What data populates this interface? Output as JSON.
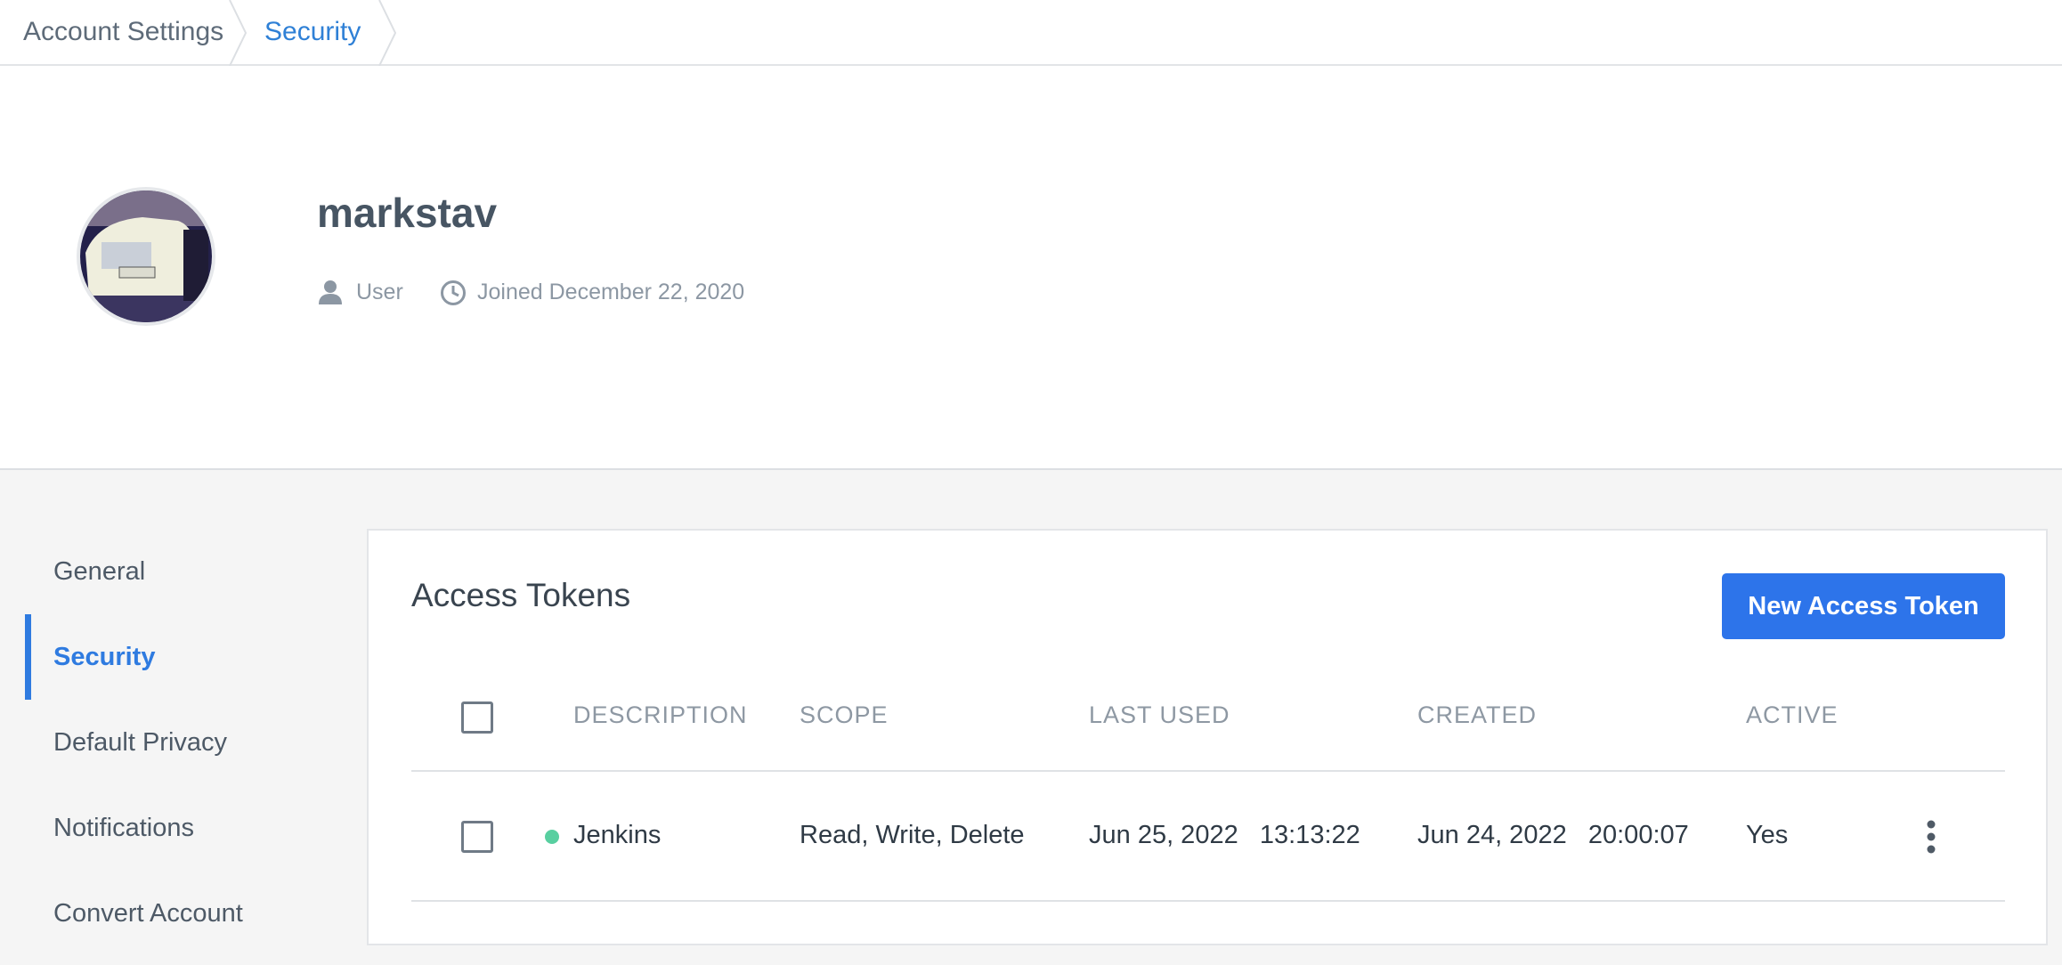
{
  "breadcrumb": {
    "items": [
      "Account Settings",
      "Security"
    ]
  },
  "profile": {
    "username": "markstav",
    "role": "User",
    "joined": "Joined December 22, 2020",
    "role_icon": "user-icon",
    "joined_icon": "clock-icon"
  },
  "sidebar": {
    "items": [
      {
        "label": "General",
        "active": false
      },
      {
        "label": "Security",
        "active": true
      },
      {
        "label": "Default Privacy",
        "active": false
      },
      {
        "label": "Notifications",
        "active": false
      },
      {
        "label": "Convert Account",
        "active": false
      }
    ]
  },
  "tokens": {
    "title": "Access Tokens",
    "new_button": "New Access Token",
    "columns": [
      "DESCRIPTION",
      "SCOPE",
      "LAST USED",
      "CREATED",
      "ACTIVE"
    ],
    "rows": [
      {
        "description": "Jenkins",
        "status_color": "#58cfa0",
        "scope": "Read, Write, Delete",
        "last_used": "Jun 25, 2022   13:13:22",
        "created": "Jun 24, 2022   20:00:07",
        "active": "Yes"
      }
    ]
  },
  "colors": {
    "accent": "#2f7be0",
    "button": "#2d74ea",
    "status_active": "#58cfa0"
  }
}
